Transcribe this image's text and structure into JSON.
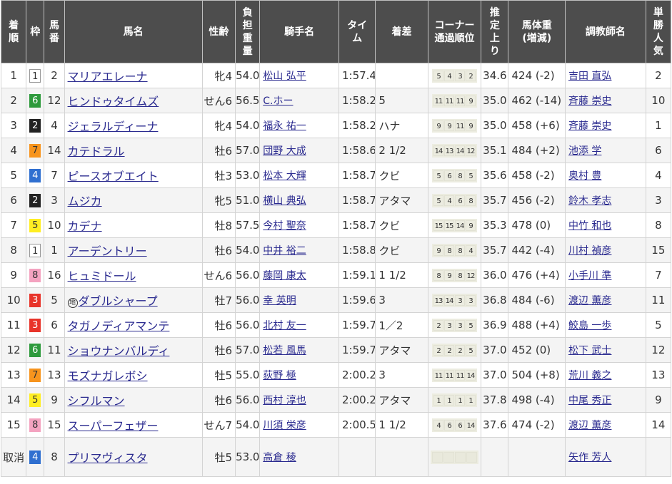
{
  "headers": {
    "rank": [
      "着",
      "順"
    ],
    "waku": [
      "枠"
    ],
    "umaban": [
      "馬",
      "番"
    ],
    "horse": [
      "馬名"
    ],
    "sexage": [
      "性齢"
    ],
    "weight": [
      "負",
      "担",
      "重",
      "量"
    ],
    "jockey": [
      "騎手名"
    ],
    "time": [
      "タイ",
      "ム"
    ],
    "margin": [
      "着差"
    ],
    "corner": [
      "コーナー",
      "通過順位"
    ],
    "last3f": [
      "推",
      "定",
      "上",
      "り"
    ],
    "bodyweight": [
      "馬体重",
      "(増減)"
    ],
    "trainer": [
      "調教師名"
    ],
    "popularity": [
      "単",
      "勝",
      "人",
      "気"
    ]
  },
  "rows": [
    {
      "rank": "1",
      "waku": "1",
      "umaban": "2",
      "mark": "",
      "horse": "マリアエレーナ",
      "sexage": "牝4",
      "weight": "54.0",
      "jockey": "松山 弘平",
      "time": "1:57.4",
      "margin": "",
      "corners": [
        "5",
        "4",
        "3",
        "2"
      ],
      "last3f": "34.6",
      "bodyweight": "424 (-2)",
      "trainer": "吉田 直弘",
      "popularity": "2"
    },
    {
      "rank": "2",
      "waku": "6",
      "umaban": "12",
      "mark": "",
      "horse": "ヒンドゥタイムズ",
      "sexage": "せん6",
      "weight": "56.5",
      "jockey": "C.ホー",
      "time": "1:58.2",
      "margin": "5",
      "corners": [
        "11",
        "11",
        "11",
        "9"
      ],
      "last3f": "35.0",
      "bodyweight": "462 (-14)",
      "trainer": "斉藤 崇史",
      "popularity": "10"
    },
    {
      "rank": "3",
      "waku": "2",
      "umaban": "4",
      "mark": "",
      "horse": "ジェラルディーナ",
      "sexage": "牝4",
      "weight": "54.0",
      "jockey": "福永 祐一",
      "time": "1:58.2",
      "margin": "ハナ",
      "corners": [
        "9",
        "9",
        "11",
        "9"
      ],
      "last3f": "35.0",
      "bodyweight": "458 (+6)",
      "trainer": "斉藤 崇史",
      "popularity": "1"
    },
    {
      "rank": "4",
      "waku": "7",
      "umaban": "14",
      "mark": "",
      "horse": "カテドラル",
      "sexage": "牡6",
      "weight": "57.0",
      "jockey": "団野 大成",
      "time": "1:58.6",
      "margin": "2 1/2",
      "corners": [
        "14",
        "13",
        "14",
        "12"
      ],
      "last3f": "35.1",
      "bodyweight": "484 (+2)",
      "trainer": "池添 学",
      "popularity": "6"
    },
    {
      "rank": "5",
      "waku": "4",
      "umaban": "7",
      "mark": "",
      "horse": "ピースオブエイト",
      "sexage": "牡3",
      "weight": "53.0",
      "jockey": "松本 大輝",
      "time": "1:58.7",
      "margin": "クビ",
      "corners": [
        "5",
        "6",
        "8",
        "5"
      ],
      "last3f": "35.6",
      "bodyweight": "458 (-2)",
      "trainer": "奥村 豊",
      "popularity": "4"
    },
    {
      "rank": "6",
      "waku": "2",
      "umaban": "3",
      "mark": "",
      "horse": "ムジカ",
      "sexage": "牝5",
      "weight": "51.0",
      "jockey": "横山 典弘",
      "time": "1:58.7",
      "margin": "アタマ",
      "corners": [
        "5",
        "4",
        "6",
        "8"
      ],
      "last3f": "35.7",
      "bodyweight": "456 (-2)",
      "trainer": "鈴木 孝志",
      "popularity": "3"
    },
    {
      "rank": "7",
      "waku": "5",
      "umaban": "10",
      "mark": "",
      "horse": "カデナ",
      "sexage": "牡8",
      "weight": "57.5",
      "jockey": "今村 聖奈",
      "time": "1:58.7",
      "margin": "クビ",
      "corners": [
        "15",
        "15",
        "14",
        "9"
      ],
      "last3f": "35.3",
      "bodyweight": "478 (0)",
      "trainer": "中竹 和也",
      "popularity": "8"
    },
    {
      "rank": "8",
      "waku": "1",
      "umaban": "1",
      "mark": "",
      "horse": "アーデントリー",
      "sexage": "牡6",
      "weight": "54.0",
      "jockey": "中井 裕二",
      "time": "1:58.8",
      "margin": "クビ",
      "corners": [
        "9",
        "8",
        "8",
        "4"
      ],
      "last3f": "35.7",
      "bodyweight": "442 (-4)",
      "trainer": "川村 禎彦",
      "popularity": "15"
    },
    {
      "rank": "9",
      "waku": "8",
      "umaban": "16",
      "mark": "",
      "horse": "ヒュミドール",
      "sexage": "せん6",
      "weight": "56.0",
      "jockey": "藤岡 康太",
      "time": "1:59.1",
      "margin": "1 1/2",
      "corners": [
        "8",
        "9",
        "8",
        "12"
      ],
      "last3f": "36.0",
      "bodyweight": "476 (+4)",
      "trainer": "小手川 準",
      "popularity": "7"
    },
    {
      "rank": "10",
      "waku": "3",
      "umaban": "5",
      "mark": "地",
      "horse": "ダブルシャープ",
      "sexage": "牡7",
      "weight": "56.0",
      "jockey": "幸 英明",
      "time": "1:59.6",
      "margin": "3",
      "corners": [
        "13",
        "14",
        "3",
        "3"
      ],
      "last3f": "36.8",
      "bodyweight": "484 (-6)",
      "trainer": "渡辺 薫彦",
      "popularity": "11"
    },
    {
      "rank": "11",
      "waku": "3",
      "umaban": "6",
      "mark": "",
      "horse": "タガノディアマンテ",
      "sexage": "牡6",
      "weight": "56.0",
      "jockey": "北村 友一",
      "time": "1:59.7",
      "margin": "1／2",
      "corners": [
        "2",
        "3",
        "3",
        "5"
      ],
      "last3f": "36.9",
      "bodyweight": "488 (+4)",
      "trainer": "鮫島 一歩",
      "popularity": "5"
    },
    {
      "rank": "12",
      "waku": "6",
      "umaban": "11",
      "mark": "",
      "horse": "ショウナンバルディ",
      "sexage": "牡6",
      "weight": "57.0",
      "jockey": "松若 風馬",
      "time": "1:59.7",
      "margin": "アタマ",
      "corners": [
        "2",
        "2",
        "2",
        "5"
      ],
      "last3f": "37.0",
      "bodyweight": "452 (0)",
      "trainer": "松下 武士",
      "popularity": "12"
    },
    {
      "rank": "13",
      "waku": "7",
      "umaban": "13",
      "mark": "",
      "horse": "モズナガレボシ",
      "sexage": "牡5",
      "weight": "55.0",
      "jockey": "荻野 極",
      "time": "2:00.2",
      "margin": "3",
      "corners": [
        "11",
        "11",
        "11",
        "14"
      ],
      "last3f": "37.0",
      "bodyweight": "504 (+8)",
      "trainer": "荒川 義之",
      "popularity": "13"
    },
    {
      "rank": "14",
      "waku": "5",
      "umaban": "9",
      "mark": "",
      "horse": "シフルマン",
      "sexage": "牡6",
      "weight": "56.0",
      "jockey": "西村 淳也",
      "time": "2:00.2",
      "margin": "アタマ",
      "corners": [
        "1",
        "1",
        "1",
        "1"
      ],
      "last3f": "37.8",
      "bodyweight": "498 (-4)",
      "trainer": "中尾 秀正",
      "popularity": "9"
    },
    {
      "rank": "15",
      "waku": "8",
      "umaban": "15",
      "mark": "",
      "horse": "スーパーフェザー",
      "sexage": "せん7",
      "weight": "54.0",
      "jockey": "川須 栄彦",
      "time": "2:00.5",
      "margin": "1 1/2",
      "corners": [
        "4",
        "6",
        "6",
        "14"
      ],
      "last3f": "37.6",
      "bodyweight": "474 (-2)",
      "trainer": "渡辺 薫彦",
      "popularity": "14"
    },
    {
      "rank": "取消",
      "waku": "4",
      "umaban": "8",
      "mark": "",
      "horse": "プリマヴィスタ",
      "sexage": "牡5",
      "weight": "53.0",
      "jockey": "高倉 稜",
      "time": "",
      "margin": "",
      "corners": [],
      "last3f": "",
      "bodyweight": "",
      "trainer": "矢作 芳人",
      "popularity": ""
    }
  ]
}
